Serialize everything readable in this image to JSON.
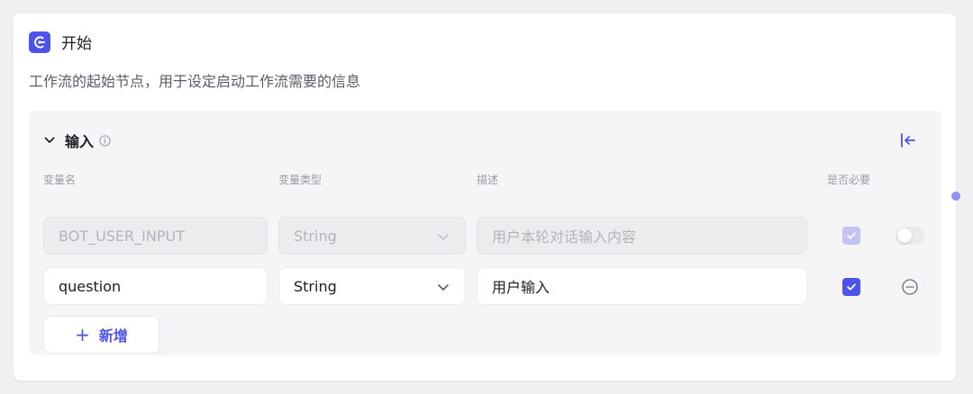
{
  "node": {
    "title": "开始",
    "description": "工作流的起始节点，用于设定启动工作流需要的信息",
    "icon": "start-node-icon"
  },
  "input_section": {
    "label": "输入",
    "info_icon": "info-icon",
    "collapse_icon": "collapse-left-icon",
    "columns": {
      "name": "变量名",
      "type": "变量类型",
      "description": "描述",
      "required": "是否必要"
    },
    "rows": [
      {
        "name": "BOT_USER_INPUT",
        "type": "String",
        "description_placeholder": "用户本轮对话输入内容",
        "required": true,
        "disabled": true,
        "toggle_on": false
      },
      {
        "name": "question",
        "type": "String",
        "description": "用户输入",
        "required": true,
        "disabled": false
      }
    ],
    "add_label": "新增",
    "add_symbol": "+"
  },
  "colors": {
    "accent": "#4d53e8",
    "accent_light": "#c2c4f3",
    "panel_bg": "#f5f5f7",
    "page_bg": "#f0f0f3"
  }
}
